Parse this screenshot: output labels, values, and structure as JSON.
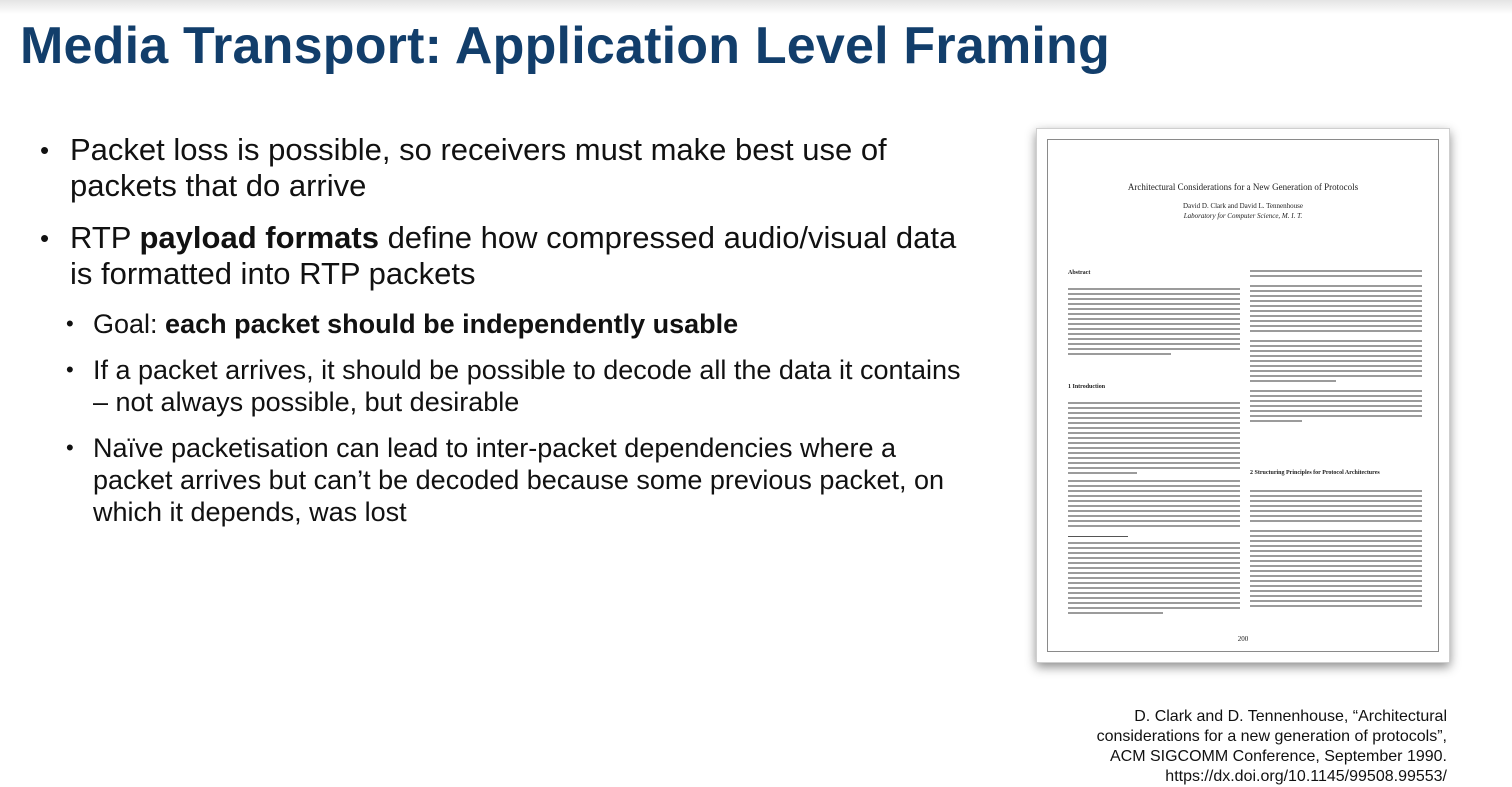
{
  "slide": {
    "title": "Media Transport: Application Level Framing"
  },
  "bullets": {
    "b1": "Packet loss is possible, so receivers must make best use of packets that do arrive",
    "b2_pre": "RTP ",
    "b2_bold": "payload formats",
    "b2_post": " define how compressed audio/visual data is formatted into RTP packets",
    "s1_pre": "Goal: ",
    "s1_bold": "each packet should be independently usable",
    "s2": "If a packet arrives, it should be possible to decode all the data it contains – not always possible, but desirable",
    "s3": "Naïve packetisation can lead to inter-packet dependencies where a packet arrives but can’t be decoded because some previous packet, on which it depends, was lost"
  },
  "paper": {
    "title": "Architectural Considerations for a New Generation of Protocols",
    "authors": "David D. Clark and David L. Tennenhouse",
    "affiliation": "Laboratory for Computer Science, M. I. T.",
    "abstract_heading": "Abstract",
    "intro_heading": "1  Introduction",
    "section2_heading": "2  Structuring Principles for Protocol Architectures",
    "page_number": "200"
  },
  "citation": {
    "line1": "D. Clark and D. Tennenhouse, “Architectural",
    "line2": "considerations for a new generation of protocols”,",
    "line3": "ACM SIGCOMM Conference, September 1990.",
    "line4": "https://dx.doi.org/10.1145/99508.99553/"
  }
}
